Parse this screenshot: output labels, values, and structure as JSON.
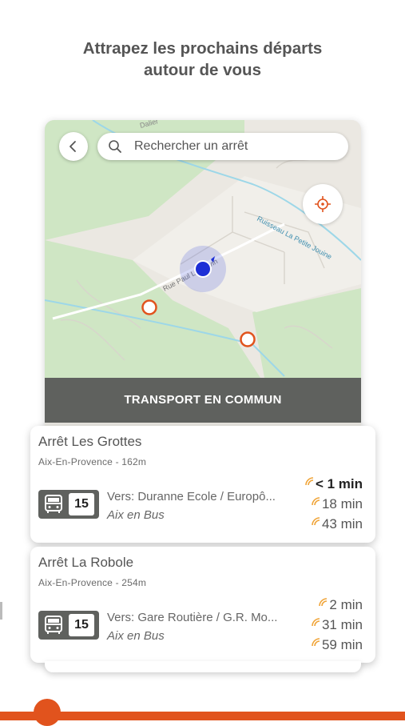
{
  "headline": {
    "line1": "Attrapez les prochains départs",
    "line2": "autour de vous"
  },
  "map": {
    "search_placeholder": "Rechercher un arrêt",
    "street_label": "Rue Paul Langevin",
    "river_label": "Ruisseau La Petite Jouine",
    "top_street_label": "Dalier",
    "colors": {
      "park": "#cfe6c4",
      "ground": "#ebe8e2",
      "stop_marker": "#e1531d",
      "user": "#1d2fd6"
    }
  },
  "filter_bar": {
    "label": "TRANSPORT EN COMMUN"
  },
  "stops": [
    {
      "name": "Arrêt Les Grottes",
      "meta": "Aix-En-Provence - 162m",
      "line": "15",
      "direction": "Vers: Duranne Ecole / Europô...",
      "network": "Aix en Bus",
      "times": [
        "< 1 min",
        "18 min",
        "43 min"
      ]
    },
    {
      "name": "Arrêt La Robole",
      "meta": "Aix-En-Provence - 254m",
      "line": "15",
      "direction": "Vers: Gare Routière / G.R. Mo...",
      "network": "Aix en Bus",
      "times": [
        "2 min",
        "31 min",
        "59 min"
      ]
    }
  ],
  "accent_color": "#e1531d"
}
